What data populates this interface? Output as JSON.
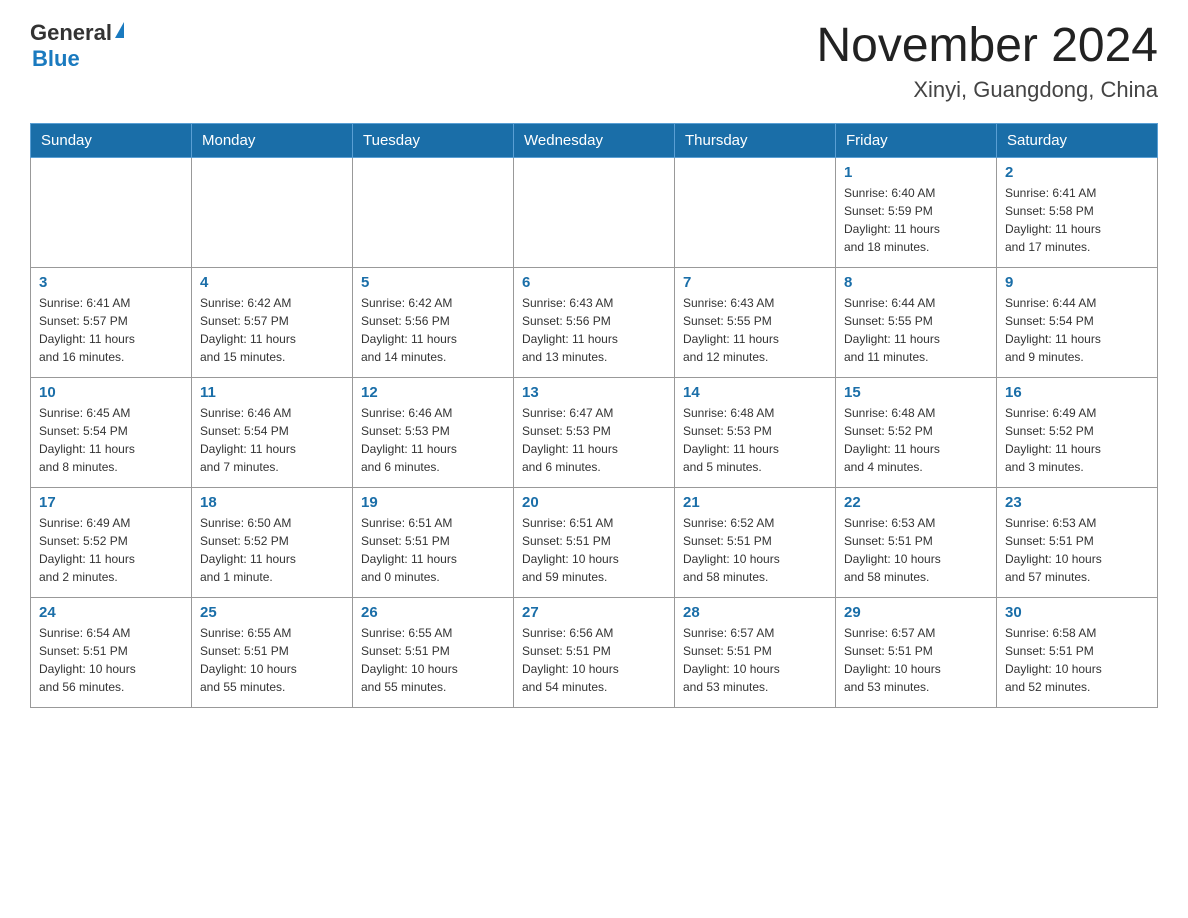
{
  "header": {
    "logo": {
      "general": "General",
      "blue": "Blue"
    },
    "title": "November 2024",
    "subtitle": "Xinyi, Guangdong, China"
  },
  "weekdays": [
    "Sunday",
    "Monday",
    "Tuesday",
    "Wednesday",
    "Thursday",
    "Friday",
    "Saturday"
  ],
  "weeks": [
    [
      {
        "day": "",
        "info": ""
      },
      {
        "day": "",
        "info": ""
      },
      {
        "day": "",
        "info": ""
      },
      {
        "day": "",
        "info": ""
      },
      {
        "day": "",
        "info": ""
      },
      {
        "day": "1",
        "info": "Sunrise: 6:40 AM\nSunset: 5:59 PM\nDaylight: 11 hours\nand 18 minutes."
      },
      {
        "day": "2",
        "info": "Sunrise: 6:41 AM\nSunset: 5:58 PM\nDaylight: 11 hours\nand 17 minutes."
      }
    ],
    [
      {
        "day": "3",
        "info": "Sunrise: 6:41 AM\nSunset: 5:57 PM\nDaylight: 11 hours\nand 16 minutes."
      },
      {
        "day": "4",
        "info": "Sunrise: 6:42 AM\nSunset: 5:57 PM\nDaylight: 11 hours\nand 15 minutes."
      },
      {
        "day": "5",
        "info": "Sunrise: 6:42 AM\nSunset: 5:56 PM\nDaylight: 11 hours\nand 14 minutes."
      },
      {
        "day": "6",
        "info": "Sunrise: 6:43 AM\nSunset: 5:56 PM\nDaylight: 11 hours\nand 13 minutes."
      },
      {
        "day": "7",
        "info": "Sunrise: 6:43 AM\nSunset: 5:55 PM\nDaylight: 11 hours\nand 12 minutes."
      },
      {
        "day": "8",
        "info": "Sunrise: 6:44 AM\nSunset: 5:55 PM\nDaylight: 11 hours\nand 11 minutes."
      },
      {
        "day": "9",
        "info": "Sunrise: 6:44 AM\nSunset: 5:54 PM\nDaylight: 11 hours\nand 9 minutes."
      }
    ],
    [
      {
        "day": "10",
        "info": "Sunrise: 6:45 AM\nSunset: 5:54 PM\nDaylight: 11 hours\nand 8 minutes."
      },
      {
        "day": "11",
        "info": "Sunrise: 6:46 AM\nSunset: 5:54 PM\nDaylight: 11 hours\nand 7 minutes."
      },
      {
        "day": "12",
        "info": "Sunrise: 6:46 AM\nSunset: 5:53 PM\nDaylight: 11 hours\nand 6 minutes."
      },
      {
        "day": "13",
        "info": "Sunrise: 6:47 AM\nSunset: 5:53 PM\nDaylight: 11 hours\nand 6 minutes."
      },
      {
        "day": "14",
        "info": "Sunrise: 6:48 AM\nSunset: 5:53 PM\nDaylight: 11 hours\nand 5 minutes."
      },
      {
        "day": "15",
        "info": "Sunrise: 6:48 AM\nSunset: 5:52 PM\nDaylight: 11 hours\nand 4 minutes."
      },
      {
        "day": "16",
        "info": "Sunrise: 6:49 AM\nSunset: 5:52 PM\nDaylight: 11 hours\nand 3 minutes."
      }
    ],
    [
      {
        "day": "17",
        "info": "Sunrise: 6:49 AM\nSunset: 5:52 PM\nDaylight: 11 hours\nand 2 minutes."
      },
      {
        "day": "18",
        "info": "Sunrise: 6:50 AM\nSunset: 5:52 PM\nDaylight: 11 hours\nand 1 minute."
      },
      {
        "day": "19",
        "info": "Sunrise: 6:51 AM\nSunset: 5:51 PM\nDaylight: 11 hours\nand 0 minutes."
      },
      {
        "day": "20",
        "info": "Sunrise: 6:51 AM\nSunset: 5:51 PM\nDaylight: 10 hours\nand 59 minutes."
      },
      {
        "day": "21",
        "info": "Sunrise: 6:52 AM\nSunset: 5:51 PM\nDaylight: 10 hours\nand 58 minutes."
      },
      {
        "day": "22",
        "info": "Sunrise: 6:53 AM\nSunset: 5:51 PM\nDaylight: 10 hours\nand 58 minutes."
      },
      {
        "day": "23",
        "info": "Sunrise: 6:53 AM\nSunset: 5:51 PM\nDaylight: 10 hours\nand 57 minutes."
      }
    ],
    [
      {
        "day": "24",
        "info": "Sunrise: 6:54 AM\nSunset: 5:51 PM\nDaylight: 10 hours\nand 56 minutes."
      },
      {
        "day": "25",
        "info": "Sunrise: 6:55 AM\nSunset: 5:51 PM\nDaylight: 10 hours\nand 55 minutes."
      },
      {
        "day": "26",
        "info": "Sunrise: 6:55 AM\nSunset: 5:51 PM\nDaylight: 10 hours\nand 55 minutes."
      },
      {
        "day": "27",
        "info": "Sunrise: 6:56 AM\nSunset: 5:51 PM\nDaylight: 10 hours\nand 54 minutes."
      },
      {
        "day": "28",
        "info": "Sunrise: 6:57 AM\nSunset: 5:51 PM\nDaylight: 10 hours\nand 53 minutes."
      },
      {
        "day": "29",
        "info": "Sunrise: 6:57 AM\nSunset: 5:51 PM\nDaylight: 10 hours\nand 53 minutes."
      },
      {
        "day": "30",
        "info": "Sunrise: 6:58 AM\nSunset: 5:51 PM\nDaylight: 10 hours\nand 52 minutes."
      }
    ]
  ]
}
